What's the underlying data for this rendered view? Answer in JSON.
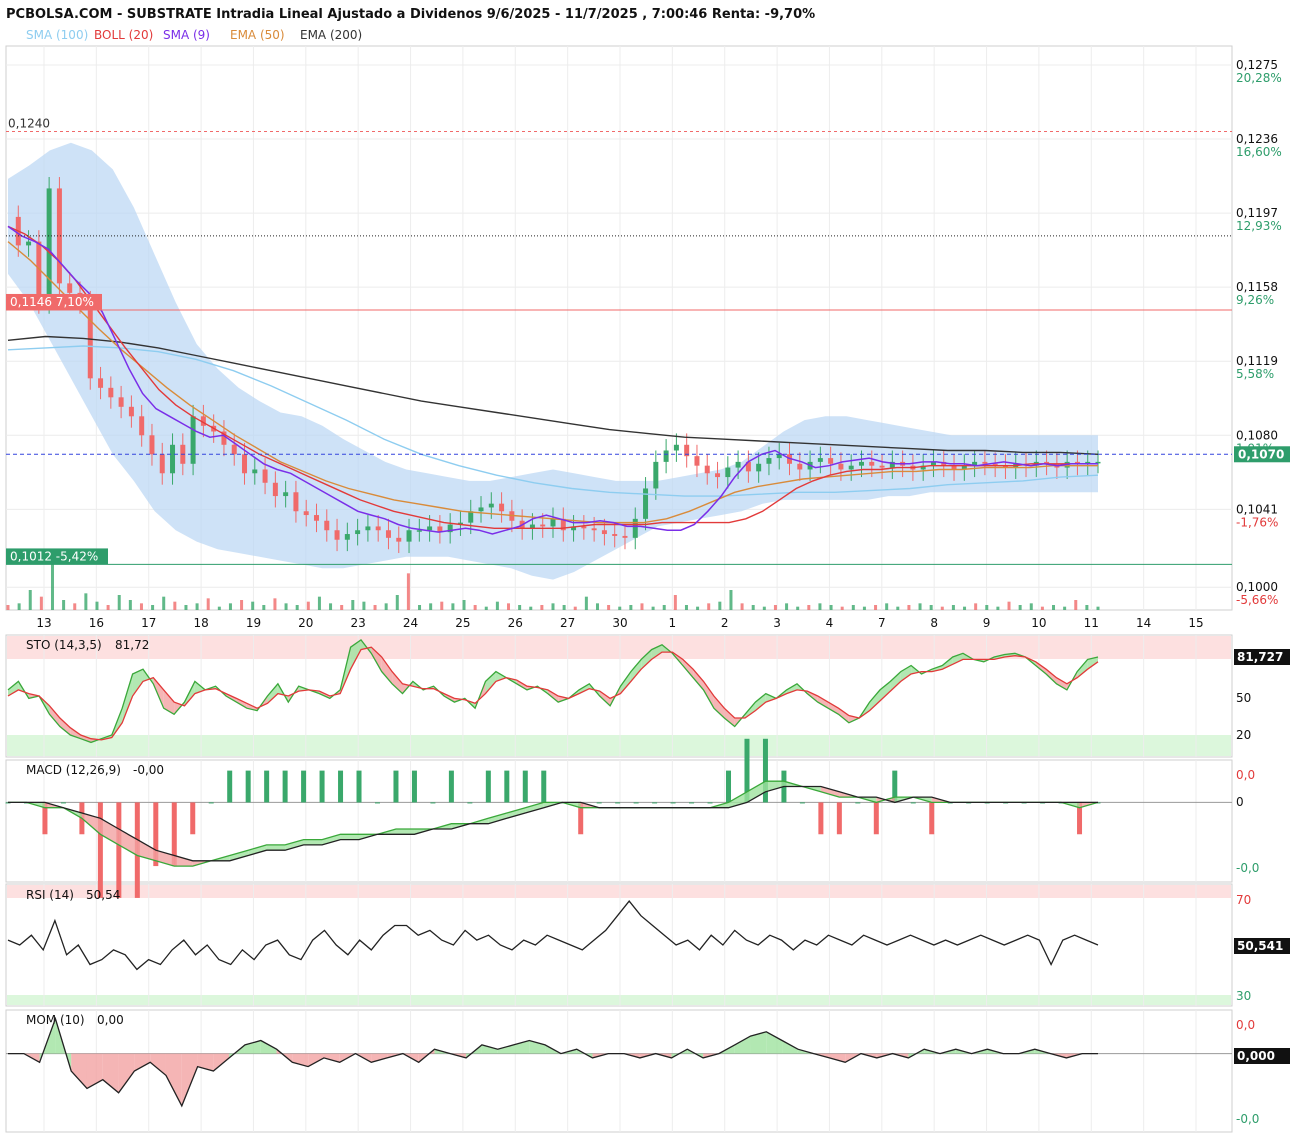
{
  "header": {
    "title": "PCBOLSA.COM - SUBSTRATE Intradia Lineal Ajustado a Dividenos 9/6/2025 - 11/7/2025 , 7:00:46 Renta: -9,70%",
    "legend": [
      {
        "label": "SMA (100)",
        "color": "#8ecdf0"
      },
      {
        "label": "BOLL (20)",
        "color": "#e23a3a"
      },
      {
        "label": "SMA (9)",
        "color": "#7a2ee8"
      },
      {
        "label": "EMA (50)",
        "color": "#d98b3a"
      },
      {
        "label": "EMA (200)",
        "color": "#333333"
      }
    ]
  },
  "colors": {
    "up": "#3aa86b",
    "down": "#f06a6a",
    "grid": "#e8e8e8",
    "bollinger": "#b9d6f3",
    "dark": "#333333"
  },
  "chart_data": [
    {
      "type": "line",
      "name": "price",
      "x_labels": [
        "13",
        "16",
        "17",
        "18",
        "19",
        "20",
        "23",
        "24",
        "25",
        "26",
        "27",
        "30",
        "1",
        "2",
        "3",
        "4",
        "7",
        "8",
        "9",
        "10",
        "11",
        "14",
        "15"
      ],
      "y_ticks": [
        {
          "value": 0.1275,
          "label": "0,1275",
          "pct": "20,28%"
        },
        {
          "value": 0.1236,
          "label": "0,1236",
          "pct": "16,60%"
        },
        {
          "value": 0.1197,
          "label": "0,1197",
          "pct": "12,93%"
        },
        {
          "value": 0.1158,
          "label": "0,1158",
          "pct": "9,26%"
        },
        {
          "value": 0.1119,
          "label": "0,1119",
          "pct": "5,58%"
        },
        {
          "value": 0.108,
          "label": "0,1080",
          "pct": "1,91%"
        },
        {
          "value": 0.1041,
          "label": "0,1041",
          "pct": "-1,76%"
        },
        {
          "value": 0.1,
          "label": "0,1000",
          "pct": "-5,66%"
        }
      ],
      "ylim": [
        0.0988,
        0.1285
      ],
      "levels": {
        "high": {
          "value": 0.124,
          "label": "0,1240"
        },
        "resistance": {
          "value": 0.1146,
          "label": "0,1146 7,10%"
        },
        "support": {
          "value": 0.1012,
          "label": "0,1012 -5,42%"
        },
        "last": {
          "value": 0.107,
          "label": "0,1070"
        },
        "dotted": 0.1185
      },
      "close": [
        0.1195,
        0.118,
        0.1182,
        0.115,
        0.121,
        0.116,
        0.1155,
        0.115,
        0.111,
        0.1105,
        0.11,
        0.1095,
        0.109,
        0.108,
        0.107,
        0.106,
        0.1075,
        0.1065,
        0.109,
        0.1085,
        0.1082,
        0.1075,
        0.107,
        0.106,
        0.1062,
        0.1055,
        0.1048,
        0.105,
        0.104,
        0.1038,
        0.1035,
        0.103,
        0.1025,
        0.1028,
        0.103,
        0.1032,
        0.103,
        0.1026,
        0.1024,
        0.103,
        0.103,
        0.1032,
        0.1029,
        0.1033,
        0.1034,
        0.104,
        0.1042,
        0.1044,
        0.104,
        0.1035,
        0.1031,
        0.1033,
        0.1032,
        0.1036,
        0.103,
        0.1032,
        0.1031,
        0.103,
        0.1028,
        0.1027,
        0.1026,
        0.1036,
        0.1052,
        0.1066,
        0.1072,
        0.1075,
        0.1069,
        0.1064,
        0.106,
        0.1058,
        0.1063,
        0.1066,
        0.1061,
        0.1065,
        0.1068,
        0.107,
        0.1065,
        0.1062,
        0.1066,
        0.1068,
        0.1065,
        0.1062,
        0.1064,
        0.1066,
        0.1064,
        0.1063,
        0.1066,
        0.1064,
        0.1062,
        0.1064,
        0.1066,
        0.1064,
        0.1062,
        0.1064,
        0.1066,
        0.1065,
        0.1064,
        0.1063,
        0.1065,
        0.1064,
        0.1066,
        0.1065,
        0.1063,
        0.1066,
        0.1065,
        0.1066,
        0.1066
      ],
      "sma9": [
        0.119,
        0.1185,
        0.1182,
        0.1178,
        0.117,
        0.1162,
        0.1155,
        0.1145,
        0.113,
        0.1115,
        0.1102,
        0.1094,
        0.109,
        0.1086,
        0.1082,
        0.1079,
        0.108,
        0.1075,
        0.107,
        0.1065,
        0.1062,
        0.106,
        0.1056,
        0.1052,
        0.1048,
        0.1044,
        0.104,
        0.1038,
        0.1036,
        0.1033,
        0.1031,
        0.103,
        0.1029,
        0.103,
        0.1031,
        0.103,
        0.1028,
        0.103,
        0.1032,
        0.1036,
        0.1038,
        0.1036,
        0.1034,
        0.1034,
        0.1035,
        0.1034,
        0.1032,
        0.1032,
        0.1031,
        0.103,
        0.103,
        0.1033,
        0.104,
        0.1048,
        0.1058,
        0.1066,
        0.107,
        0.1072,
        0.1068,
        0.1066,
        0.1063,
        0.1064,
        0.1066,
        0.1067,
        0.1068,
        0.1066,
        0.1065,
        0.1065,
        0.1066,
        0.1066,
        0.1065,
        0.1065,
        0.1064,
        0.1065,
        0.1066,
        0.1065,
        0.1064,
        0.1065,
        0.1064,
        0.1065,
        0.1065,
        0.1065
      ],
      "boll_mid": [
        0.119,
        0.1186,
        0.118,
        0.1172,
        0.1162,
        0.115,
        0.1138,
        0.1126,
        0.1115,
        0.1104,
        0.1096,
        0.109,
        0.1085,
        0.108,
        0.1075,
        0.107,
        0.1066,
        0.1062,
        0.1058,
        0.1054,
        0.105,
        0.1046,
        0.1043,
        0.104,
        0.1038,
        0.1036,
        0.1034,
        0.1033,
        0.1032,
        0.1031,
        0.1031,
        0.1031,
        0.1031,
        0.1031,
        0.1032,
        0.1033,
        0.1033,
        0.1033,
        0.1033,
        0.1034,
        0.1034,
        0.1034,
        0.1034,
        0.1034,
        0.1036,
        0.104,
        0.1046,
        0.1052,
        0.1056,
        0.1059,
        0.1061,
        0.1062,
        0.1062,
        0.1063,
        0.1063,
        0.1064,
        0.1064,
        0.1064,
        0.1064,
        0.1064,
        0.1064,
        0.1065,
        0.1065,
        0.1065,
        0.1065,
        0.1065
      ],
      "boll_upper": [
        0.1215,
        0.1222,
        0.123,
        0.1234,
        0.123,
        0.122,
        0.12,
        0.1175,
        0.115,
        0.1128,
        0.1115,
        0.1105,
        0.1098,
        0.1092,
        0.109,
        0.1085,
        0.1078,
        0.1072,
        0.1066,
        0.1062,
        0.106,
        0.1058,
        0.1056,
        0.1056,
        0.1058,
        0.106,
        0.1062,
        0.106,
        0.1058,
        0.1056,
        0.1056,
        0.1056,
        0.1058,
        0.106,
        0.1062,
        0.1066,
        0.1074,
        0.1082,
        0.1088,
        0.109,
        0.109,
        0.1088,
        0.1086,
        0.1084,
        0.1082,
        0.108,
        0.108,
        0.108,
        0.108,
        0.108,
        0.108,
        0.108,
        0.108
      ],
      "boll_lower": [
        0.1165,
        0.115,
        0.113,
        0.111,
        0.109,
        0.107,
        0.1056,
        0.104,
        0.103,
        0.1024,
        0.102,
        0.1018,
        0.1016,
        0.1014,
        0.1012,
        0.101,
        0.101,
        0.1012,
        0.1014,
        0.1016,
        0.1016,
        0.1016,
        0.1014,
        0.1012,
        0.101,
        0.1006,
        0.1004,
        0.1008,
        0.1014,
        0.102,
        0.1026,
        0.1032,
        0.1034,
        0.1036,
        0.1038,
        0.104,
        0.1044,
        0.1046,
        0.1046,
        0.1046,
        0.1046,
        0.1046,
        0.1048,
        0.1048,
        0.105,
        0.105,
        0.105,
        0.105,
        0.105,
        0.105,
        0.105,
        0.105,
        0.105
      ],
      "ema50": [
        0.1182,
        0.1172,
        0.116,
        0.1148,
        0.1136,
        0.1125,
        0.1115,
        0.1105,
        0.1096,
        0.1088,
        0.108,
        0.1073,
        0.1066,
        0.1061,
        0.1056,
        0.1052,
        0.1049,
        0.1046,
        0.1044,
        0.1042,
        0.104,
        0.1039,
        0.1038,
        0.1037,
        0.1036,
        0.1035,
        0.1034,
        0.1034,
        0.1034,
        0.1036,
        0.104,
        0.1045,
        0.105,
        0.1053,
        0.1055,
        0.1057,
        0.1058,
        0.1059,
        0.106,
        0.1061,
        0.1061,
        0.1062,
        0.1062,
        0.1063,
        0.1063,
        0.1063,
        0.1064,
        0.1064,
        0.1064
      ],
      "ema200": [
        0.113,
        0.1132,
        0.1131,
        0.1129,
        0.1126,
        0.1122,
        0.1118,
        0.1114,
        0.111,
        0.1106,
        0.1102,
        0.1098,
        0.1095,
        0.1092,
        0.1089,
        0.1086,
        0.1083,
        0.1081,
        0.1079,
        0.1078,
        0.1077,
        0.1076,
        0.1075,
        0.1074,
        0.1073,
        0.1072,
        0.1072,
        0.1071,
        0.1071,
        0.107
      ],
      "sma100": [
        0.1125,
        0.1126,
        0.1127,
        0.1126,
        0.1124,
        0.112,
        0.1114,
        0.1106,
        0.1097,
        0.1088,
        0.1078,
        0.107,
        0.1064,
        0.1059,
        0.1055,
        0.1052,
        0.105,
        0.1049,
        0.1048,
        0.1048,
        0.1049,
        0.105,
        0.105,
        0.1051,
        0.1052,
        0.1054,
        0.1055,
        0.1056,
        0.1058,
        0.1059
      ]
    },
    {
      "type": "line",
      "name": "STO (14,3,5)",
      "value_label": "81,72",
      "last_label": "81,727",
      "ylim": [
        0,
        100
      ],
      "ticks": [
        {
          "value": 50,
          "label": "50"
        },
        {
          "value": 20,
          "label": "20"
        }
      ],
      "k": [
        55,
        62,
        48,
        50,
        35,
        25,
        18,
        15,
        12,
        15,
        18,
        40,
        68,
        72,
        60,
        40,
        35,
        45,
        62,
        55,
        58,
        50,
        45,
        40,
        38,
        50,
        60,
        45,
        58,
        55,
        52,
        48,
        55,
        90,
        96,
        85,
        70,
        60,
        52,
        62,
        55,
        58,
        50,
        45,
        48,
        40,
        62,
        70,
        65,
        60,
        55,
        58,
        52,
        45,
        48,
        55,
        60,
        50,
        42,
        58,
        70,
        80,
        88,
        92,
        85,
        75,
        65,
        55,
        40,
        32,
        25,
        35,
        45,
        52,
        48,
        55,
        60,
        52,
        45,
        40,
        35,
        28,
        32,
        45,
        55,
        62,
        70,
        75,
        68,
        72,
        75,
        82,
        85,
        80,
        78,
        82,
        84,
        85,
        82,
        75,
        68,
        60,
        55,
        70,
        80,
        82
      ],
      "d": [
        50,
        55,
        52,
        50,
        42,
        32,
        24,
        18,
        15,
        14,
        16,
        28,
        50,
        62,
        65,
        55,
        45,
        42,
        52,
        55,
        56,
        52,
        48,
        44,
        40,
        44,
        52,
        50,
        54,
        55,
        54,
        50,
        52,
        72,
        88,
        90,
        82,
        70,
        60,
        58,
        56,
        56,
        52,
        48,
        47,
        44,
        52,
        62,
        65,
        63,
        58,
        57,
        55,
        50,
        48,
        52,
        56,
        54,
        48,
        52,
        62,
        72,
        80,
        86,
        86,
        80,
        72,
        62,
        50,
        40,
        32,
        32,
        38,
        45,
        48,
        52,
        55,
        54,
        50,
        45,
        40,
        34,
        32,
        38,
        46,
        54,
        62,
        68,
        70,
        70,
        72,
        76,
        80,
        80,
        80,
        80,
        82,
        83,
        82,
        78,
        72,
        65,
        60,
        65,
        72,
        78
      ]
    },
    {
      "type": "line",
      "name": "MACD (12,26,9)",
      "value_label": "-0,00",
      "ticks": [
        {
          "value": 0.0005,
          "label": "0,0"
        },
        {
          "value": 0,
          "label": "0"
        },
        {
          "value": -0.0012,
          "label": "-0,0"
        }
      ],
      "ylim": [
        -0.0015,
        0.0008
      ],
      "macd": [
        0.0,
        0.0,
        -0.0001,
        -0.0001,
        -0.0003,
        -0.0006,
        -0.0008,
        -0.001,
        -0.0011,
        -0.0012,
        -0.0012,
        -0.0011,
        -0.001,
        -0.0009,
        -0.0008,
        -0.0008,
        -0.0007,
        -0.0007,
        -0.0006,
        -0.0006,
        -0.0006,
        -0.0005,
        -0.0005,
        -0.0005,
        -0.0004,
        -0.0004,
        -0.0003,
        -0.0002,
        -0.0001,
        0.0,
        0.0,
        -0.0001,
        -0.0001,
        -0.0001,
        -0.0001,
        -0.0001,
        -0.0001,
        -0.0001,
        -0.0001,
        0.0,
        0.0002,
        0.0004,
        0.0004,
        0.0003,
        0.0002,
        0.0001,
        0.0001,
        0.0,
        0.0001,
        0.0001,
        0.0,
        0.0,
        0.0,
        0.0,
        0.0,
        0.0,
        0.0,
        0.0,
        -0.0001,
        0.0
      ],
      "signal": [
        0.0,
        0.0,
        0.0,
        -0.0001,
        -0.0002,
        -0.0003,
        -0.0005,
        -0.0007,
        -0.0009,
        -0.001,
        -0.0011,
        -0.0011,
        -0.0011,
        -0.001,
        -0.0009,
        -0.0009,
        -0.0008,
        -0.0008,
        -0.0007,
        -0.0007,
        -0.0006,
        -0.0006,
        -0.0006,
        -0.0005,
        -0.0005,
        -0.0004,
        -0.0004,
        -0.0003,
        -0.0002,
        -0.0001,
        0.0,
        0.0,
        -0.0001,
        -0.0001,
        -0.0001,
        -0.0001,
        -0.0001,
        -0.0001,
        -0.0001,
        -0.0001,
        0.0,
        0.0002,
        0.0003,
        0.0003,
        0.0003,
        0.0002,
        0.0001,
        0.0001,
        0.0,
        0.0001,
        0.0001,
        0.0,
        0.0,
        0.0,
        0.0,
        0.0,
        0.0,
        0.0,
        0.0,
        0.0
      ]
    },
    {
      "type": "line",
      "name": "RSI (14)",
      "value_label": "50,54",
      "last_label": "50,541",
      "ylim": [
        25,
        75
      ],
      "ticks": [
        {
          "value": 70,
          "label": "70"
        },
        {
          "value": 30,
          "label": "30"
        }
      ],
      "values": [
        52,
        50,
        54,
        48,
        60,
        46,
        50,
        42,
        44,
        48,
        46,
        40,
        44,
        42,
        48,
        52,
        46,
        50,
        44,
        42,
        48,
        44,
        50,
        52,
        46,
        44,
        52,
        56,
        50,
        46,
        52,
        48,
        54,
        58,
        58,
        54,
        56,
        52,
        50,
        56,
        52,
        54,
        50,
        48,
        52,
        50,
        54,
        52,
        50,
        48,
        52,
        56,
        62,
        68,
        62,
        58,
        54,
        50,
        52,
        48,
        54,
        50,
        56,
        52,
        50,
        54,
        52,
        48,
        52,
        50,
        54,
        52,
        50,
        54,
        52,
        50,
        52,
        54,
        52,
        50,
        52,
        50,
        52,
        54,
        52,
        50,
        52,
        54,
        52,
        42,
        52,
        54,
        52,
        50
      ]
    },
    {
      "type": "area",
      "name": "MOM (10)",
      "value_label": "0,00",
      "last_label": "0,000",
      "ticks": [
        {
          "value": 0.0008,
          "label": "0,0"
        },
        {
          "value": -0.0015,
          "label": "-0,0"
        }
      ],
      "ylim": [
        -0.0018,
        0.001
      ],
      "values": [
        0.0,
        0.0,
        -0.0002,
        0.0008,
        -0.0004,
        -0.0008,
        -0.0006,
        -0.0009,
        -0.0004,
        -0.0002,
        -0.0005,
        -0.0012,
        -0.0003,
        -0.0004,
        -0.0001,
        0.0002,
        0.0003,
        0.0001,
        -0.0002,
        -0.0003,
        -0.0001,
        -0.0002,
        0.0,
        -0.0002,
        -0.0001,
        0.0,
        -0.0002,
        0.0001,
        0.0,
        -0.0001,
        0.0002,
        0.0001,
        0.0002,
        0.0003,
        0.0002,
        0.0,
        0.0001,
        -0.0001,
        0.0,
        0.0,
        -0.0001,
        0.0,
        -0.0001,
        0.0001,
        -0.0001,
        0.0,
        0.0002,
        0.0004,
        0.0005,
        0.0003,
        0.0001,
        0.0,
        -0.0001,
        -0.0002,
        0.0,
        -0.0001,
        0.0,
        -0.0001,
        0.0001,
        0.0,
        0.0001,
        0.0,
        0.0001,
        0.0,
        0.0,
        0.0001,
        0.0,
        -0.0001,
        0.0,
        0.0
      ]
    },
    {
      "type": "bar",
      "name": "volume",
      "values": [
        3,
        4,
        12,
        8,
        30,
        6,
        4,
        10,
        5,
        3,
        9,
        6,
        4,
        3,
        8,
        5,
        3,
        4,
        7,
        2,
        4,
        6,
        5,
        3,
        7,
        4,
        3,
        5,
        8,
        4,
        3,
        6,
        5,
        3,
        4,
        9,
        22,
        3,
        4,
        5,
        4,
        6,
        3,
        2,
        5,
        4,
        3,
        2,
        3,
        4,
        3,
        2,
        8,
        4,
        3,
        2,
        3,
        4,
        2,
        3,
        9,
        3,
        2,
        4,
        5,
        12,
        4,
        3,
        2,
        3,
        4,
        2,
        3,
        4,
        3,
        2,
        3,
        2,
        3,
        4,
        2,
        3,
        4,
        3,
        2,
        3,
        2,
        4,
        3,
        2,
        5,
        3,
        4,
        2,
        3,
        2,
        6,
        3,
        2
      ]
    }
  ]
}
